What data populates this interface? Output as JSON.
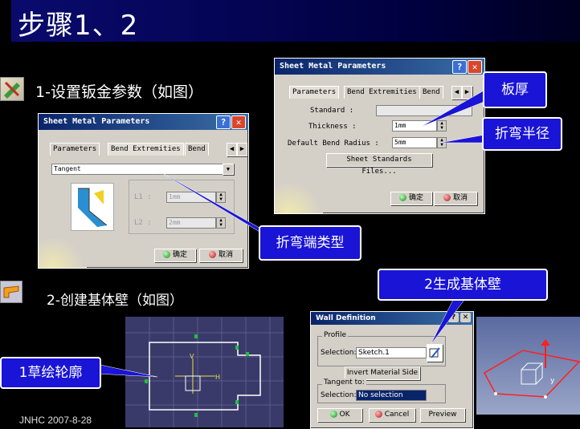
{
  "page": {
    "title": "步骤1、2",
    "footer": "JNHC 2007-8-28"
  },
  "steps": {
    "step1": "1-设置钣金参数（如图）",
    "step2": "2-创建基体壁（如图）"
  },
  "callouts": {
    "thickness": "板厚",
    "bend_radius": "折弯半径",
    "bend_end_type": "折弯端类型",
    "generate_wall": "2生成基体壁",
    "sketch_profile": "1草绘轮廓"
  },
  "dialog_small": {
    "title": "Sheet Metal Parameters",
    "tabs": [
      "Parameters",
      "Bend Extremities",
      "Bend "
    ],
    "selected_tab": "Bend Extremities",
    "dropdown_value": "Tangent",
    "l1_label": "L1 :",
    "l1_value": "1mm",
    "l2_label": "L2 :",
    "l2_value": "2mm",
    "ok_label": "确定",
    "cancel_label": "取消"
  },
  "dialog_large": {
    "title": "Sheet Metal Parameters",
    "tabs": [
      "Parameters",
      "Bend Extremities",
      "Bend "
    ],
    "selected_tab": "Parameters",
    "standard_label": "Standard :",
    "standard_value": "",
    "thickness_label": "Thickness :",
    "thickness_value": "1mm",
    "radius_label": "Default Bend Radius :",
    "radius_value": "5mm",
    "standards_button": "Sheet Standards Files...",
    "ok_label": "确定",
    "cancel_label": "取消"
  },
  "wall_dialog": {
    "title": "Wall Definition",
    "profile_group": "Profile",
    "selection_label": "Selection:",
    "selection_value": "Sketch.1",
    "invert_button": "Invert Material Side",
    "tangent_group": "Tangent to:",
    "tangent_selection_label": "Selection:",
    "tangent_selection_value": "No selection",
    "ok_label": "OK",
    "cancel_label": "Cancel",
    "preview_label": "Preview"
  },
  "sketch": {
    "axis_h": "H",
    "axis_v": "V"
  },
  "view3d": {
    "axis_y": "y"
  },
  "colors": {
    "callout": "#1a14d6",
    "title_bg": "#0a0a6e",
    "sketch_bg": "#3a3a6a"
  }
}
